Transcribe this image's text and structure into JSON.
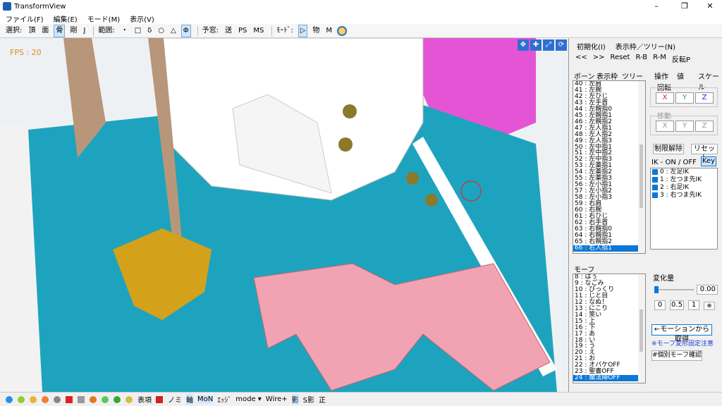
{
  "window": {
    "title": "TransformView",
    "minimize": "–",
    "maximize": "❐",
    "close": "✕"
  },
  "menu": [
    "ファイル(F)",
    "編集(E)",
    "モード(M)",
    "表示(V)"
  ],
  "toolbar": {
    "select_label": "選択:",
    "select": [
      "頂",
      "面",
      "骨",
      "剛",
      "J"
    ],
    "range_label": "範囲:",
    "range": [
      "・",
      "□",
      "δ",
      "○",
      "△",
      "Φ"
    ],
    "prepare_label": "予窓:",
    "prepare": [
      "送",
      "PS",
      "MS"
    ],
    "mode_label": "ﾓｰﾄﾞ:",
    "mode": [
      "▷",
      "物",
      "M"
    ]
  },
  "viewport": {
    "fps": "FPS : 20"
  },
  "right_panel": {
    "top_tabs": [
      "初期化(I)",
      "表示枠／ツリー(N)"
    ],
    "top_buttons": [
      "<<",
      ">>",
      "Reset",
      "R-B",
      "R-M",
      "反転P"
    ],
    "bone_tabs": [
      "ボーン",
      "表示枠",
      "ツリー"
    ],
    "bones": [
      "40 : 左肩",
      "41 : 左腕",
      "42 : 左ひじ",
      "43 : 左手首",
      "44 : 左親指0",
      "45 : 左親指1",
      "46 : 左親指2",
      "47 : 左人指1",
      "48 : 左人指2",
      "49 : 左人指3",
      "50 : 左中指1",
      "51 : 左中指2",
      "52 : 左中指3",
      "53 : 左薬指1",
      "54 : 左薬指2",
      "55 : 左薬指3",
      "56 : 左小指1",
      "57 : 左小指2",
      "58 : 左小指3",
      "59 : 右肩",
      "60 : 右腕",
      "61 : 右ひじ",
      "62 : 右手首",
      "63 : 右親指0",
      "64 : 右親指1",
      "65 : 右親指2",
      "66 : 右人指1"
    ],
    "op_tabs": [
      "操作",
      "値",
      "スケール"
    ],
    "rotate_label": "回転",
    "rotate_axes": [
      "X",
      "Y",
      "Z"
    ],
    "move_label": "移動",
    "move_axes": [
      "X",
      "Y",
      "Z"
    ],
    "limit_release": "制限解除",
    "reset": "リセット",
    "ik_label": "IK - ON / OFF",
    "ik_key": "Key",
    "ik_items": [
      "0 : 左足IK",
      "1 : 左つま先IK",
      "2 : 右足IK",
      "3 : 右つま先IK"
    ],
    "morph_label": "モーフ",
    "morphs": [
      "8 : はぅ",
      "9 : なごみ",
      "10 : びっくり",
      "11 : じと目",
      "12 : なぬ！",
      "13 : にこり",
      "14 : 笑い",
      "15 : 上",
      "16 : 下",
      "17 : あ",
      "18 : い",
      "19 : う",
      "20 : え",
      "21 : お",
      "22 : オバケOFF",
      "23 : 聖書OFF",
      "24 : 魔法陣OFF"
    ],
    "amount_label": "変化量",
    "amount_value": "0.00",
    "amount_level": 0.0,
    "amount_buttons": [
      "0",
      "0.5",
      "1"
    ],
    "get_from_motion": "←モーションから取得",
    "morph_warning": "※モーフ変形固定注意",
    "individual_morph": "#個別モーフ確認"
  },
  "statusbar": {
    "items": [
      "表項",
      "ノミ",
      "軸",
      "MoN",
      "ｴｯｼﾞ",
      "mode ▾",
      "Wire+",
      "影",
      "S影",
      "正"
    ]
  },
  "colors": {
    "accent": "#0b78d7",
    "shirt": "#1ea3bf",
    "bow": "#f1a3b4",
    "magenta": "#e23ad0"
  }
}
